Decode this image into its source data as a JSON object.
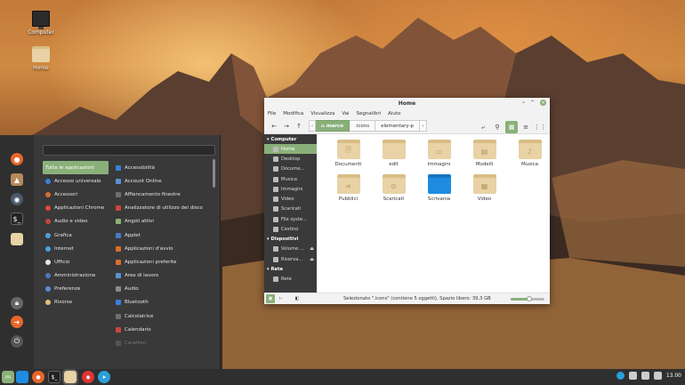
{
  "desktop": {
    "icons": [
      {
        "label": "Computer",
        "kind": "monitor-icon"
      },
      {
        "label": "Home",
        "kind": "folder-icon"
      }
    ]
  },
  "menu": {
    "search_placeholder": "",
    "categories": [
      {
        "label": "Tutte le applicazioni",
        "selected": true,
        "color": ""
      },
      {
        "label": "Accesso universale",
        "color": "#3b7fd8"
      },
      {
        "label": "Accessori",
        "color": "#d76f2b"
      },
      {
        "label": "Applicazioni Chrome",
        "color": "#e04b3a"
      },
      {
        "label": "Audio e video",
        "color": "#c6463f"
      },
      {
        "label": "Grafica",
        "color": "#4aa3df"
      },
      {
        "label": "Internet",
        "color": "#4aa3df"
      },
      {
        "label": "Ufficio",
        "color": "#e7e7e7"
      },
      {
        "label": "Amministrazione",
        "color": "#4a79c5"
      },
      {
        "label": "Preferenze",
        "color": "#5b8fd6"
      },
      {
        "label": "Risorse",
        "color": "#e0c07a"
      }
    ],
    "apps": [
      {
        "label": "Accessibilità",
        "color": "#3b7fd8"
      },
      {
        "label": "Account Online",
        "color": "#5b8fd6"
      },
      {
        "label": "Affiancamento finestre",
        "color": "#6f6f6f"
      },
      {
        "label": "Analizzatore di utilizzo del disco",
        "color": "#c6463f"
      },
      {
        "label": "Angoli attivi",
        "color": "#8ab07a"
      },
      {
        "label": "Applet",
        "color": "#4a79c5"
      },
      {
        "label": "Applicazioni d'avvio",
        "color": "#d76f2b"
      },
      {
        "label": "Applicazioni preferite",
        "color": "#d76f2b"
      },
      {
        "label": "Aree di lavoro",
        "color": "#5b8fd6"
      },
      {
        "label": "Audio",
        "color": "#8a8a8a"
      },
      {
        "label": "Bluetooth",
        "color": "#3b7fd8"
      },
      {
        "label": "Calcolatrice",
        "color": "#6f6f6f"
      },
      {
        "label": "Calendario",
        "color": "#c6463f"
      },
      {
        "label": "Caratteri",
        "color": "#555555",
        "faded": true
      }
    ],
    "favorites": [
      "firefox-icon",
      "image-viewer-icon",
      "disks-icon",
      "terminal-icon",
      "folder-icon"
    ],
    "session": [
      "lock-icon",
      "logout-icon",
      "power-icon"
    ]
  },
  "file_manager": {
    "title": "Home",
    "menubar": [
      "File",
      "Modifica",
      "Visualizza",
      "Vai",
      "Segnalibri",
      "Aiuto"
    ],
    "breadcrumbs": [
      "marco",
      ".icons",
      "elementary-p"
    ],
    "sidebar": {
      "computer_header": "Computer",
      "computer_items": [
        "Home",
        "Desktop",
        "Docume...",
        "Musica",
        "Immagini",
        "Video",
        "Scaricati",
        "File syste...",
        "Cestino"
      ],
      "devices_header": "Dispositivi",
      "devices_items": [
        "Volume ...",
        "Riserva..."
      ],
      "network_header": "Rete",
      "network_items": [
        "Rete"
      ]
    },
    "files": [
      {
        "label": "Documenti",
        "glyph": "🗎"
      },
      {
        "label": "edit",
        "glyph": ""
      },
      {
        "label": "Immagini",
        "glyph": "▭"
      },
      {
        "label": "Modelli",
        "glyph": "▤"
      },
      {
        "label": "Musica",
        "glyph": "♪"
      },
      {
        "label": "Pubblici",
        "glyph": "⋖"
      },
      {
        "label": "Scaricati",
        "glyph": "⊙"
      },
      {
        "label": "Scrivania",
        "glyph": "",
        "blue": true
      },
      {
        "label": "Video",
        "glyph": "▦"
      }
    ],
    "status_text": "Selezionato \".icons\" (contiene 5 oggetti), Spazio libero: 39,3 GB",
    "zoom_level": 0.55
  },
  "taskbar": {
    "clock": "13.00",
    "apps": [
      "mint-menu-icon",
      "show-desktop-icon",
      "firefox-icon",
      "terminal-icon",
      "files-icon",
      "chrome-icon",
      "telegram-icon"
    ]
  },
  "colors": {
    "accent": "#8ab07a"
  }
}
